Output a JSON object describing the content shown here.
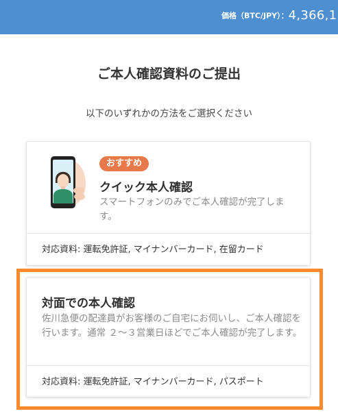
{
  "header": {
    "price_label": "価格（BTC/JPY）：",
    "price_value": "4,366,1",
    "bg_color": "#4d8fd0"
  },
  "main": {
    "title": "ご本人確認資料のご提出",
    "subtitle": "以下のいずれかの方法をご選択ください"
  },
  "options": [
    {
      "badge": "おすすめ",
      "title": "クイック本人確認",
      "description": "スマートフォンのみでご本人確認が完了します。",
      "documents": "対応資料: 運転免許証, マイナンバーカード, 在留カード",
      "icon": "smartphone-selfie-icon"
    },
    {
      "title": "対面での本人確認",
      "description": "佐川急便の配達員がお客様のご自宅にお伺いし、ご本人確認を行います。通常 ２～３営業日ほどでご本人確認が完了します。",
      "documents": "対応資料: 運転免許証, マイナンバーカード, パスポート",
      "selected": true,
      "highlight_color": "#fb8a2e"
    }
  ]
}
